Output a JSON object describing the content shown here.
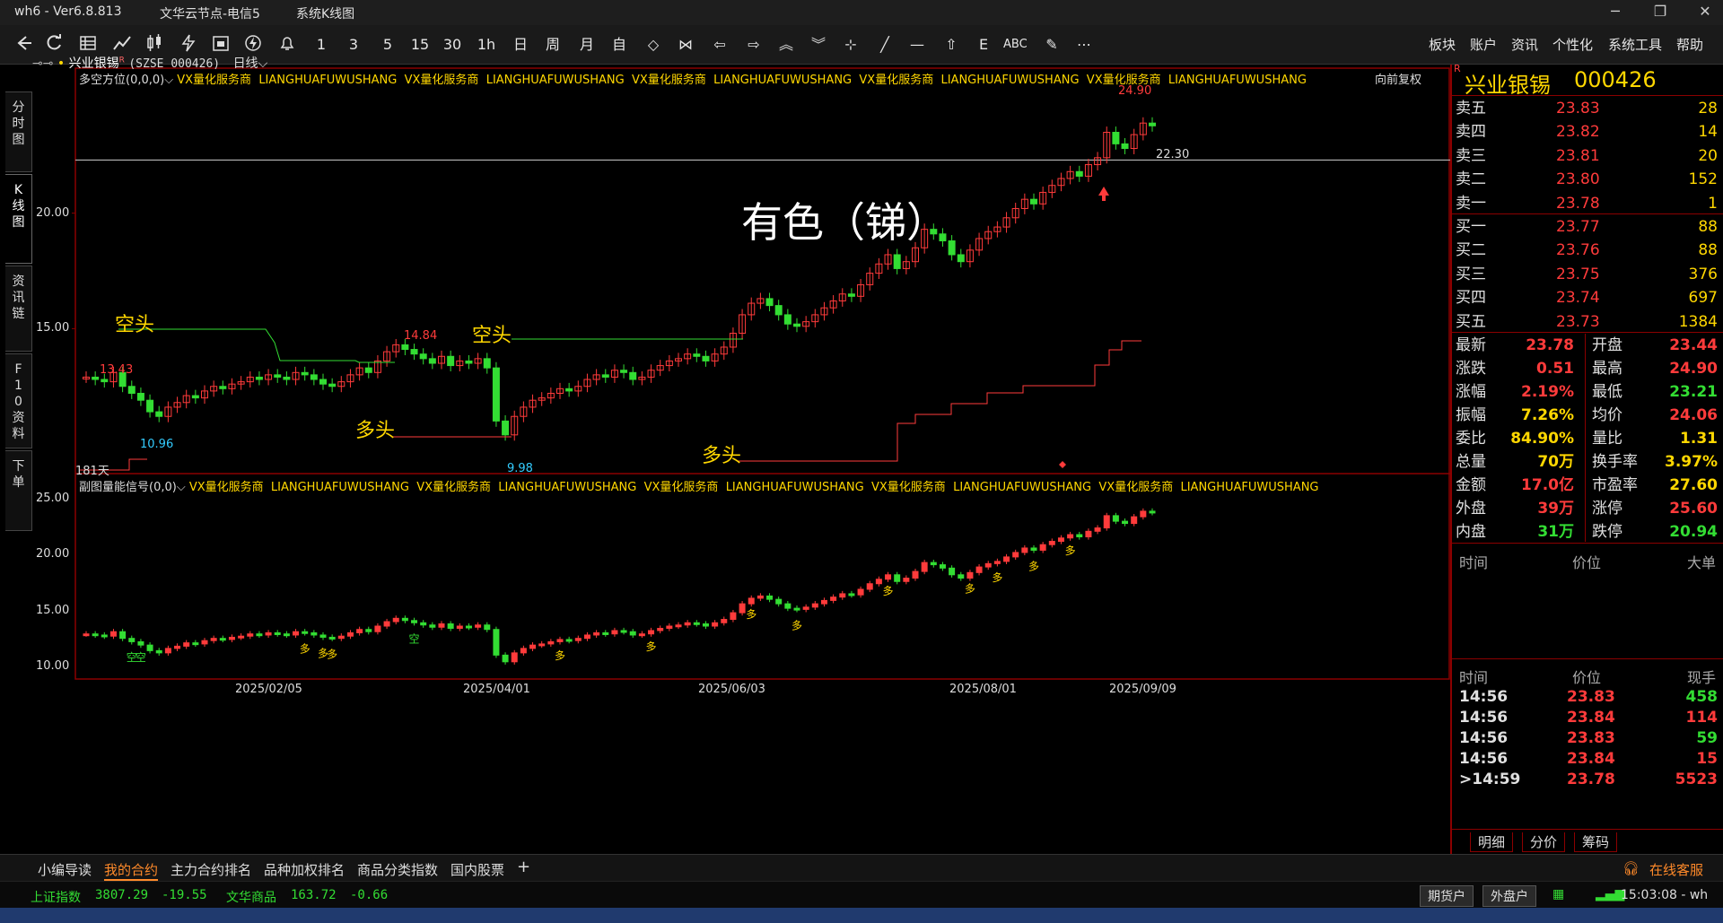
{
  "window": {
    "title": "wh6  -  Ver6.8.813",
    "server": "文华云节点-电信5",
    "view": "系统K线图",
    "controls": [
      "─",
      "❐",
      "✕"
    ]
  },
  "toolbar": {
    "icons": [
      "back-icon",
      "refresh-icon",
      "table-icon",
      "line-chart-icon",
      "kline-icon",
      "flash-icon",
      "calendar-icon",
      "cloud-icon",
      "bell-icon"
    ],
    "periods": [
      "1",
      "3",
      "5",
      "15",
      "30",
      "1h",
      "日",
      "周",
      "月",
      "自"
    ],
    "menus": [
      "板块",
      "账户",
      "资讯",
      "个性化",
      "系统工具",
      "帮助"
    ]
  },
  "left_tabs": [
    "分时图",
    "K线图",
    "资讯链",
    "F10资料",
    "下单"
  ],
  "chart_header": {
    "symbol": "兴业银锡",
    "code": "(SZSE 000426)",
    "period": "日线",
    "indicator": "多空方位(0,0,0)",
    "vendor1": "VX量化服务商",
    "vendor2": "LIANGHUAFUWUSHANG",
    "adjust": "向前复权",
    "sub_indicator": "副图量能信号(0,0)"
  },
  "chart_data": [
    {
      "type": "candlestick",
      "name": "main",
      "yticks": [
        20.0,
        15.0
      ],
      "ytick_labels": [
        "20.00",
        "15.00"
      ],
      "ylim": [
        9.5,
        25.5
      ],
      "hline": 22.3,
      "hline_label": "22.30",
      "annotations": {
        "high_max": "24.90",
        "mid_high": "14.84",
        "left_high": "13.43",
        "left_low": "10.96",
        "mid_low": "9.98",
        "days": "181天",
        "big_text": "有色（锑）",
        "kong1": "空头",
        "kong2": "空头",
        "duo1": "多头",
        "duo2": "多头"
      },
      "series": [
        {
          "name": "close",
          "values": [
            12.9,
            12.8,
            12.7,
            13.1,
            12.5,
            12.2,
            11.9,
            11.4,
            11.2,
            11.6,
            11.8,
            12.1,
            12.0,
            12.3,
            12.5,
            12.4,
            12.6,
            12.7,
            12.9,
            12.8,
            13.0,
            12.9,
            12.8,
            13.1,
            13.0,
            12.8,
            12.6,
            12.5,
            12.7,
            13.0,
            13.3,
            13.1,
            13.6,
            14.0,
            14.3,
            14.1,
            13.9,
            13.7,
            13.5,
            13.8,
            13.4,
            13.6,
            13.5,
            13.7,
            13.3,
            11.0,
            10.4,
            11.2,
            11.6,
            11.9,
            12.0,
            12.2,
            12.4,
            12.3,
            12.5,
            12.8,
            13.0,
            12.9,
            13.2,
            13.1,
            12.8,
            12.9,
            13.2,
            13.4,
            13.6,
            13.7,
            13.9,
            13.8,
            13.6,
            13.9,
            14.2,
            14.8,
            15.6,
            16.1,
            16.3,
            16.0,
            15.6,
            15.2,
            15.1,
            15.3,
            15.6,
            15.9,
            16.2,
            16.5,
            16.4,
            16.9,
            17.4,
            17.8,
            18.2,
            17.6,
            17.9,
            18.5,
            19.3,
            19.1,
            18.8,
            18.2,
            17.9,
            18.4,
            18.9,
            19.2,
            19.4,
            19.8,
            20.2,
            20.6,
            20.4,
            20.9,
            21.2,
            21.5,
            21.8,
            21.6,
            22.1,
            22.4,
            23.5,
            23.0,
            22.8,
            23.4,
            23.9,
            23.78
          ]
        }
      ]
    },
    {
      "type": "candlestick",
      "name": "sub",
      "yticks": [
        25.0,
        20.0,
        15.0,
        10.0
      ],
      "ytick_labels": [
        "25.00",
        "20.00",
        "15.00",
        "10.00"
      ],
      "ylim": [
        9.5,
        25.5
      ],
      "signals": [
        "空",
        "空",
        "多",
        "多",
        "多",
        "空",
        "多",
        "多",
        "多",
        "多",
        "多",
        "多",
        "多",
        "多",
        "多"
      ]
    }
  ],
  "xaxis_labels": [
    "2025/02/05",
    "2025/04/01",
    "2025/06/03",
    "2025/08/01",
    "2025/09/09"
  ],
  "quote": {
    "name": "兴业银锡",
    "code": "000426",
    "badge": "R",
    "asks": [
      {
        "label": "卖五",
        "price": "23.83",
        "vol": "28"
      },
      {
        "label": "卖四",
        "price": "23.82",
        "vol": "14"
      },
      {
        "label": "卖三",
        "price": "23.81",
        "vol": "20"
      },
      {
        "label": "卖二",
        "price": "23.80",
        "vol": "152"
      },
      {
        "label": "卖一",
        "price": "23.78",
        "vol": "1"
      }
    ],
    "bids": [
      {
        "label": "买一",
        "price": "23.77",
        "vol": "88"
      },
      {
        "label": "买二",
        "price": "23.76",
        "vol": "88"
      },
      {
        "label": "买三",
        "price": "23.75",
        "vol": "376"
      },
      {
        "label": "买四",
        "price": "23.74",
        "vol": "697"
      },
      {
        "label": "买五",
        "price": "23.73",
        "vol": "1384"
      }
    ],
    "stats": [
      {
        "l1": "最新",
        "v1": "23.78",
        "c1": "red",
        "l2": "开盘",
        "v2": "23.44",
        "c2": "red"
      },
      {
        "l1": "涨跌",
        "v1": "0.51",
        "c1": "red",
        "l2": "最高",
        "v2": "24.90",
        "c2": "red"
      },
      {
        "l1": "涨幅",
        "v1": "2.19%",
        "c1": "red",
        "l2": "最低",
        "v2": "23.21",
        "c2": "green"
      },
      {
        "l1": "振幅",
        "v1": "7.26%",
        "c1": "yellow",
        "l2": "均价",
        "v2": "24.06",
        "c2": "red"
      },
      {
        "l1": "委比",
        "v1": "84.90%",
        "c1": "yellow",
        "l2": "量比",
        "v2": "1.31",
        "c2": "yellow"
      },
      {
        "l1": "总量",
        "v1": "70万",
        "c1": "yellow",
        "l2": "换手率",
        "v2": "3.97%",
        "c2": "yellow"
      },
      {
        "l1": "金额",
        "v1": "17.0亿",
        "c1": "red",
        "l2": "市盈率",
        "v2": "27.60",
        "c2": "yellow"
      },
      {
        "l1": "外盘",
        "v1": "39万",
        "c1": "red",
        "l2": "涨停",
        "v2": "25.60",
        "c2": "red"
      },
      {
        "l1": "内盘",
        "v1": "31万",
        "c1": "green",
        "l2": "跌停",
        "v2": "20.94",
        "c2": "green"
      }
    ],
    "big_header": {
      "time": "时间",
      "price": "价位",
      "big": "大单"
    },
    "ticks_header": {
      "time": "时间",
      "price": "价位",
      "vol": "现手"
    },
    "ticks": [
      {
        "time": "14:56",
        "price": "23.83",
        "vol": "458",
        "vc": "green"
      },
      {
        "time": "14:56",
        "price": "23.84",
        "vol": "114",
        "vc": "red"
      },
      {
        "time": "14:56",
        "price": "23.83",
        "vol": "59",
        "vc": "green"
      },
      {
        "time": "14:56",
        "price": "23.84",
        "vol": "15",
        "vc": "red"
      },
      {
        "time": ">14:59",
        "price": "23.78",
        "vol": "5523",
        "vc": "red"
      }
    ],
    "subtabs": [
      "明细",
      "分价",
      "筹码"
    ]
  },
  "bottom_tabs": [
    "小编导读",
    "我的合约",
    "主力合约排名",
    "品种加权排名",
    "商品分类指数",
    "国内股票",
    "+"
  ],
  "service": "在线客服",
  "status": {
    "idx1_name": "上证指数",
    "idx1_val": "3807.29",
    "idx1_chg": "-19.55",
    "idx2_name": "文华商品",
    "idx2_val": "163.72",
    "idx2_chg": "-0.66",
    "btn1": "期货户",
    "btn2": "外盘户",
    "time": "15:03:08 - wh"
  },
  "colors": {
    "up": "#ff3b3b",
    "down": "#33dd33",
    "border": "#8b0000",
    "label": "#ffd700"
  }
}
